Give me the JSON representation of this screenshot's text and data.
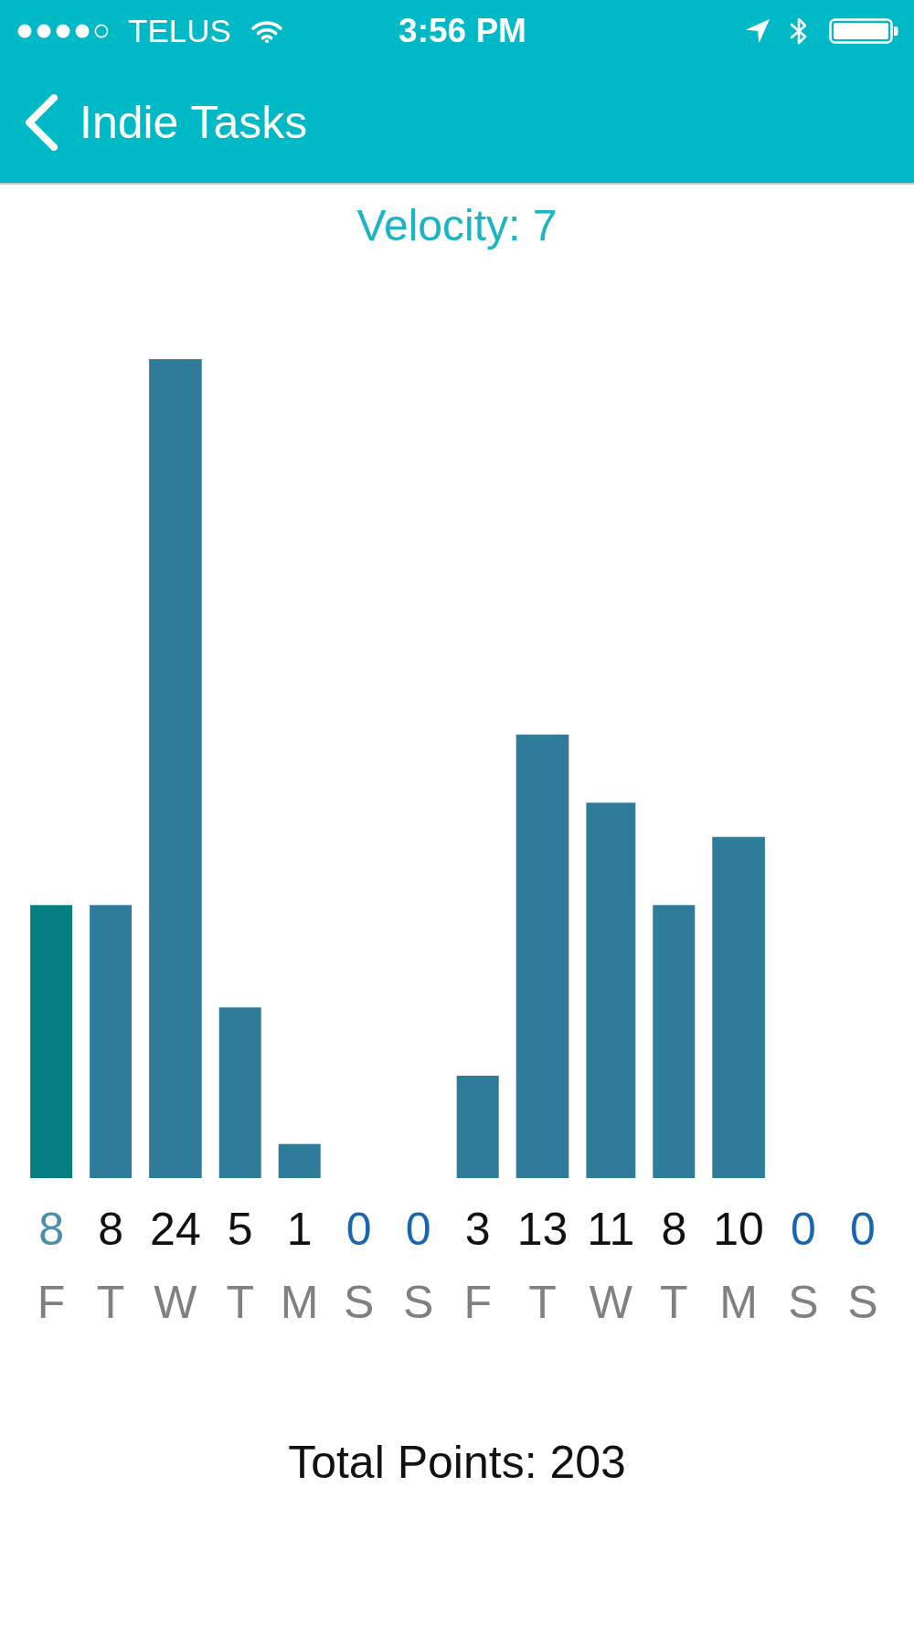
{
  "status_bar": {
    "carrier": "TELUS",
    "time": "3:56 PM"
  },
  "nav_bar": {
    "back_label": "Indie Tasks"
  },
  "velocity": "Velocity: 7",
  "chart": {
    "chart_data": {
      "type": "bar",
      "categories": [
        "F",
        "T",
        "W",
        "T",
        "M",
        "S",
        "S",
        "F",
        "T",
        "W",
        "T",
        "M",
        "S",
        "S"
      ],
      "series": [
        {
          "color": "#067f83",
          "values": [
            8,
            null,
            null,
            null,
            null,
            null,
            null,
            null,
            null,
            null,
            null,
            null,
            null,
            null
          ]
        },
        {
          "color": "#2e7b9a",
          "values": [
            null,
            8,
            24,
            5,
            1,
            0,
            0,
            3,
            13,
            11,
            8,
            10,
            0,
            0
          ]
        }
      ],
      "stacked": true,
      "data_labels": true
    }
  },
  "total_points": "Total Points: 203"
}
